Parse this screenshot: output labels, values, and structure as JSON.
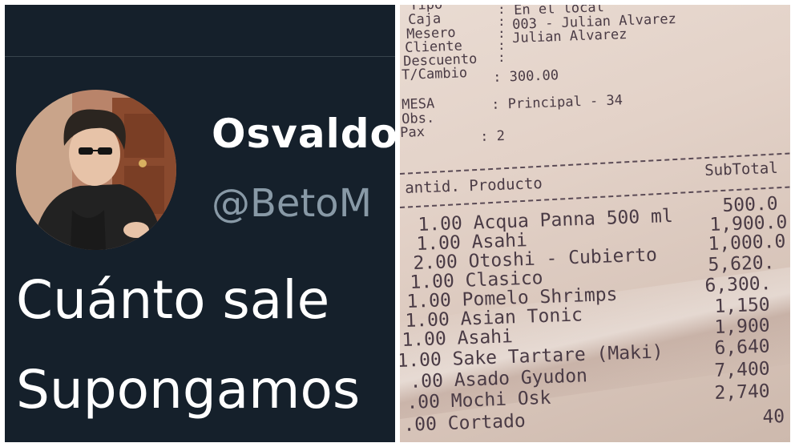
{
  "tweet": {
    "display_name": "Osvaldo",
    "handle": "@BetoM",
    "text_line1": "Cuánto sale",
    "text_line2": "Supongamos"
  },
  "receipt": {
    "header_labels": [
      "Tipo",
      "Caja",
      "Mesero",
      "Cliente",
      "Descuento",
      "T/Cambio"
    ],
    "tipo": "En el local",
    "caja": "003 - Julian Alvarez",
    "mesero": "Julian Alvarez",
    "tcambio": ": 300.00",
    "mesa_label": "MESA",
    "obs_label": "Obs.",
    "pax_label": "Pax",
    "mesa_value": ": Principal - 34",
    "pax_value": ": 2",
    "col_product": "antid. Producto",
    "col_subtotal": "SubTotal",
    "items": [
      {
        "line": "1.00 Acqua Panna 500 ml",
        "amount": "500.0"
      },
      {
        "line": "1.00 Asahi",
        "amount": "1,900.0"
      },
      {
        "line": "2.00 Otoshi - Cubierto",
        "amount": "1,000.0"
      },
      {
        "line": "1.00 Clasico",
        "amount": "5,620."
      },
      {
        "line": "1.00 Pomelo Shrimps",
        "amount": "6,300."
      },
      {
        "line": "1.00 Asian Tonic",
        "amount": "1,150"
      },
      {
        "line": "1.00 Asahi",
        "amount": "1,900"
      },
      {
        "line": "1.00 Sake Tartare (Maki)",
        "amount": "6,640"
      },
      {
        "line": ".00 Asado Gyudon",
        "amount": "7,400"
      },
      {
        "line": ".00 Mochi Osk",
        "amount": "2,740"
      },
      {
        "line": ".00 Cortado",
        "amount": "40"
      }
    ]
  }
}
